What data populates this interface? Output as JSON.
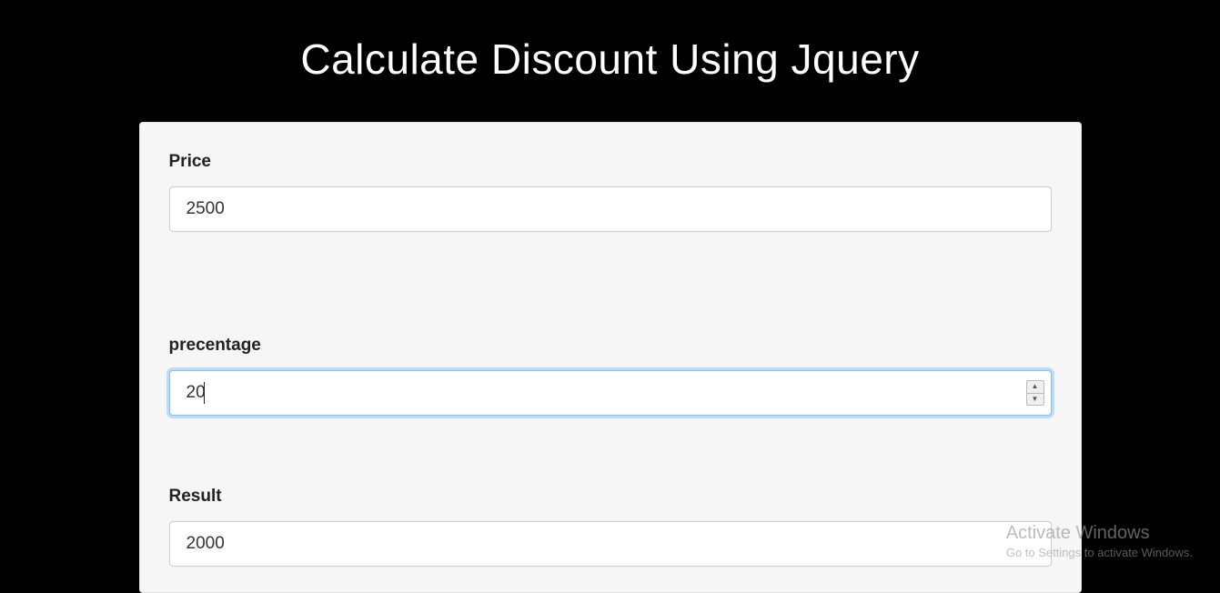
{
  "page": {
    "title": "Calculate Discount Using Jquery"
  },
  "form": {
    "price": {
      "label": "Price",
      "value": "2500"
    },
    "percentage": {
      "label": "precentage",
      "value": "20"
    },
    "result": {
      "label": "Result",
      "value": "2000"
    }
  },
  "watermark": {
    "title": "Activate Windows",
    "subtitle": "Go to Settings to activate Windows."
  }
}
